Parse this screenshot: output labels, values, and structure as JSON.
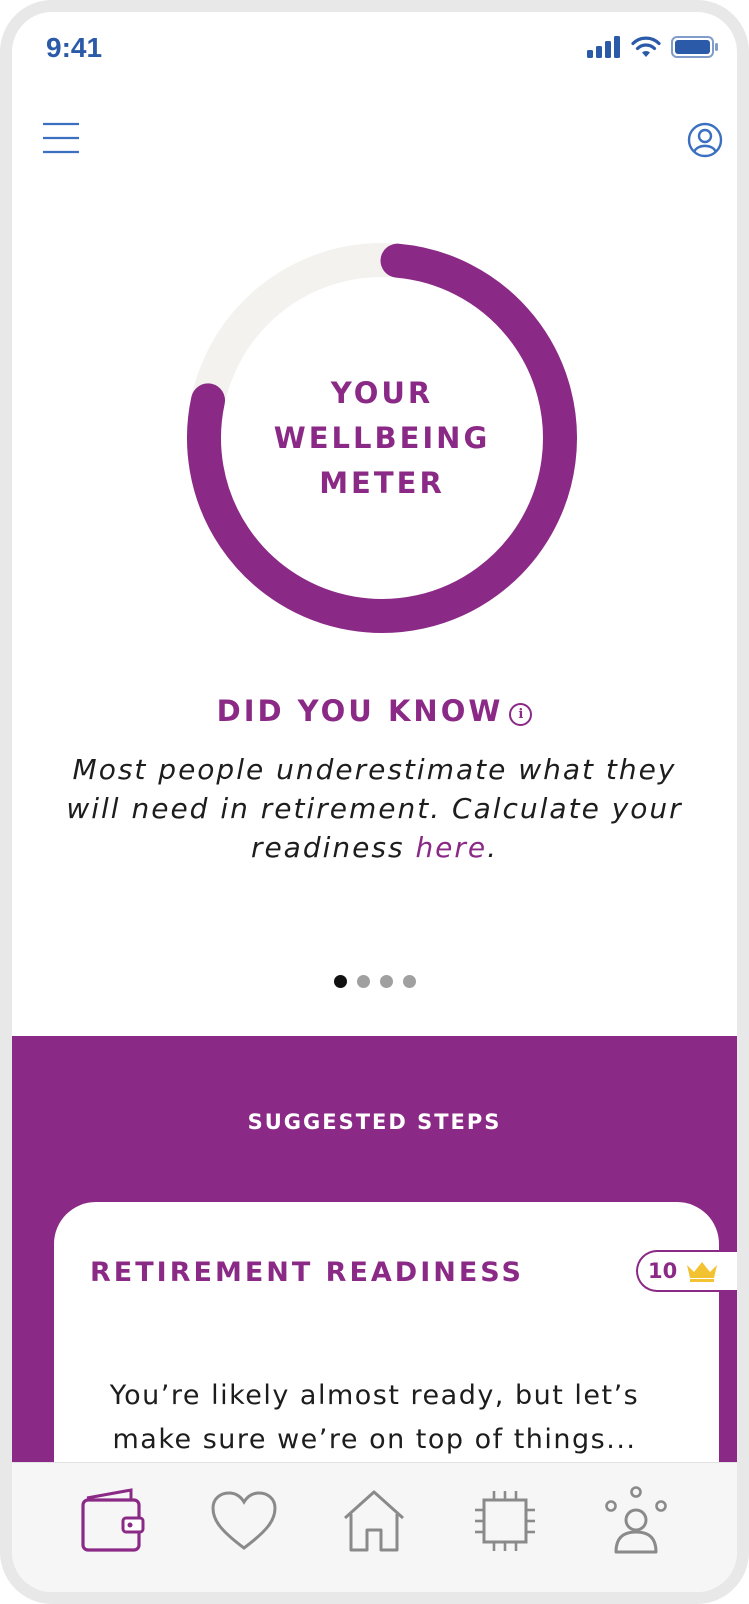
{
  "status_bar": {
    "time": "9:41"
  },
  "meter": {
    "label_lines": [
      "YOUR",
      "WELLBEING",
      "METER"
    ],
    "progress_fraction": 0.77,
    "fill_color": "#8b2a86",
    "track_color": "#f4f2ef"
  },
  "did_you_know": {
    "heading": "DID YOU KNOW",
    "info_glyph": "i",
    "text_before_link": "Most people underestimate what they will need in retirement. Calculate your readiness ",
    "link_text": "here",
    "text_after_link": "."
  },
  "carousel": {
    "pages": 4,
    "active_index": 0
  },
  "suggested_steps": {
    "title": "SUGGESTED STEPS",
    "card": {
      "title": "RETIREMENT READINESS",
      "points": "10",
      "body": "You’re likely almost ready, but let’s make sure we’re on top of things..."
    }
  },
  "nav": {
    "items": [
      {
        "name": "wallet",
        "active": true
      },
      {
        "name": "heart",
        "active": false
      },
      {
        "name": "home",
        "active": false
      },
      {
        "name": "chip",
        "active": false
      },
      {
        "name": "community",
        "active": false
      }
    ]
  },
  "colors": {
    "brand_purple": "#8b2a86",
    "status_blue": "#2b5aa8",
    "icon_blue": "#3b6fbf",
    "nav_inactive": "#8a8a8a",
    "crown_gold": "#f2c230"
  }
}
